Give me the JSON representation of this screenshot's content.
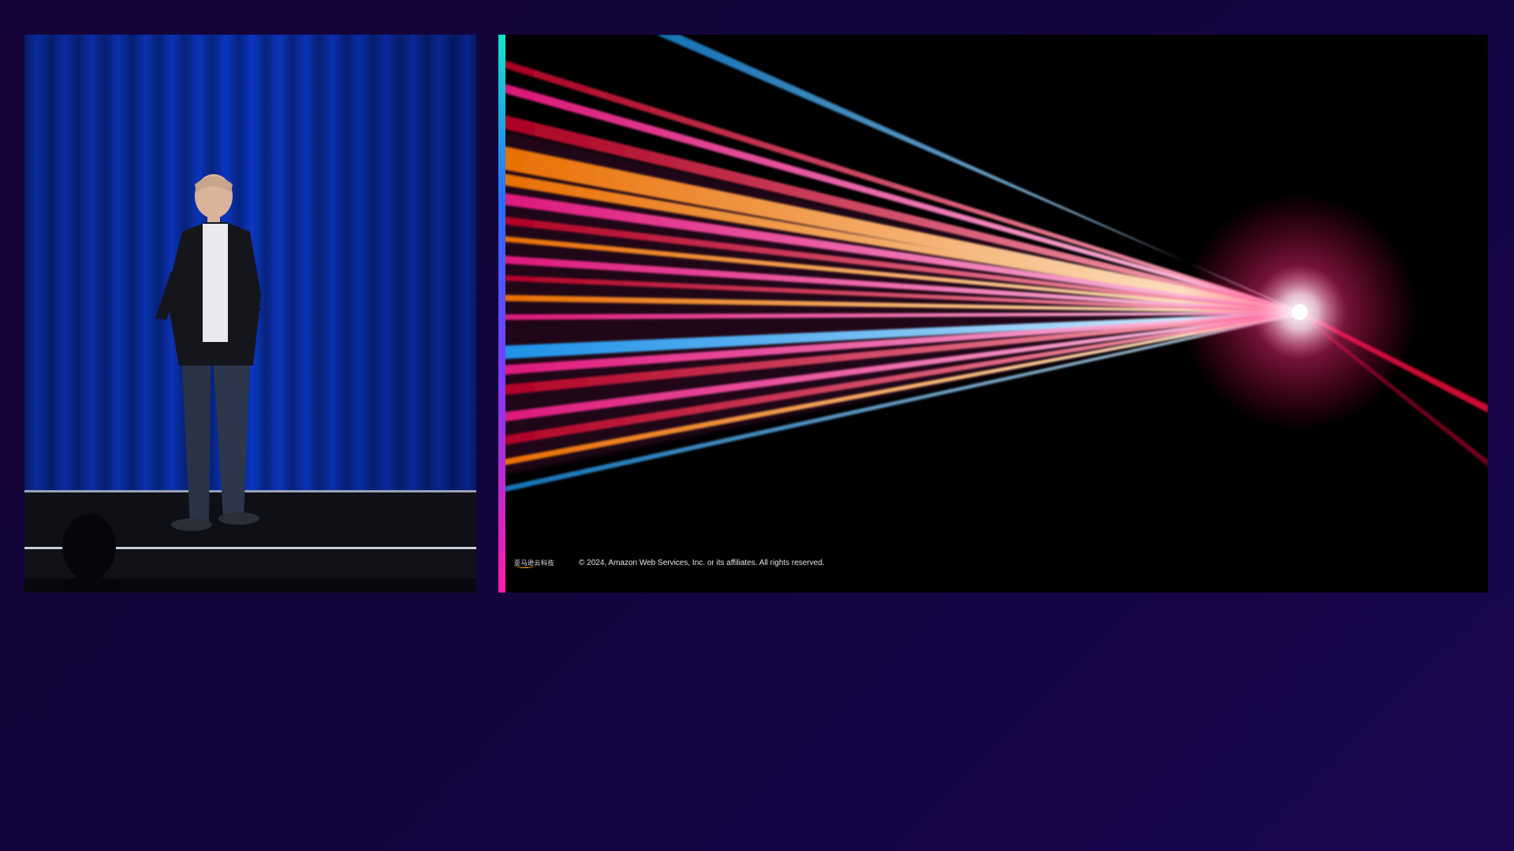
{
  "slide": {
    "logo_text": "亚马逊云科技",
    "copyright": "© 2024, Amazon Web Services, Inc. or its affiliates. All rights reserved."
  },
  "colors": {
    "background": "#15043a",
    "accent_top": "#12e6c8",
    "accent_bottom": "#ff1aa5",
    "aws_orange": "#ff9900"
  },
  "icons": {
    "logo": "aws-smile-logo"
  }
}
